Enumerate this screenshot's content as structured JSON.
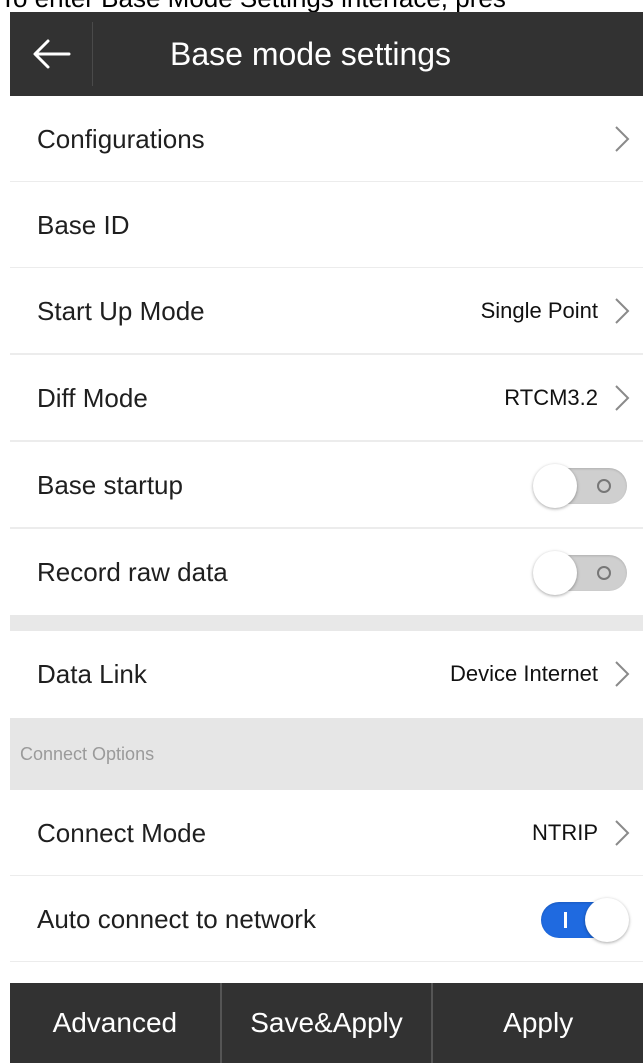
{
  "caption": {
    "text": "To enter Base Mode Settings interface, pres"
  },
  "header": {
    "title": "Base mode settings",
    "back_icon": "arrow-left-icon"
  },
  "rows": [
    {
      "label": "Configurations",
      "value": ""
    },
    {
      "label": "Base ID",
      "value": ""
    },
    {
      "label": "Start Up Mode",
      "value": "Single Point"
    },
    {
      "label": "Diff Mode",
      "value": "RTCM3.2"
    },
    {
      "label": "Base startup",
      "toggle": "off"
    },
    {
      "label": "Record raw data",
      "toggle": "off"
    },
    {
      "label": "Data Link",
      "value": "Device Internet"
    },
    {
      "label": "Connect Mode",
      "value": "NTRIP"
    },
    {
      "label": "Auto connect to network",
      "toggle": "on"
    }
  ],
  "section": {
    "connect_options": "Connect Options"
  },
  "bottom_bar": {
    "advanced": "Advanced",
    "save_apply": "Save&Apply",
    "apply": "Apply"
  },
  "colors": {
    "title_bar": "#323232",
    "toggle_on": "#1f6ae0",
    "section_bg": "#e6e6e6"
  }
}
